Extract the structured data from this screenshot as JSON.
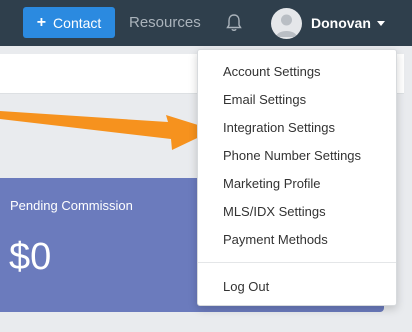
{
  "topbar": {
    "contact_button": "Contact",
    "resources_link": "Resources",
    "username": "Donovan",
    "icons": {
      "plus": "plus-icon",
      "bell": "bell-icon",
      "avatar": "avatar-icon",
      "caret": "chevron-down-icon"
    },
    "bg_color": "#2f3f4c",
    "accent_color": "#2b8ae0"
  },
  "dropdown": {
    "items": [
      "Account Settings",
      "Email Settings",
      "Integration Settings",
      "Phone Number Settings",
      "Marketing Profile",
      "MLS/IDX Settings",
      "Payment Methods"
    ],
    "logout": "Log Out"
  },
  "card": {
    "title": "Pending Commission",
    "amount": "$0",
    "color": "#6b7bbd"
  },
  "annotation": {
    "arrow_color": "#f6921e",
    "points_to": "Integration Settings"
  }
}
